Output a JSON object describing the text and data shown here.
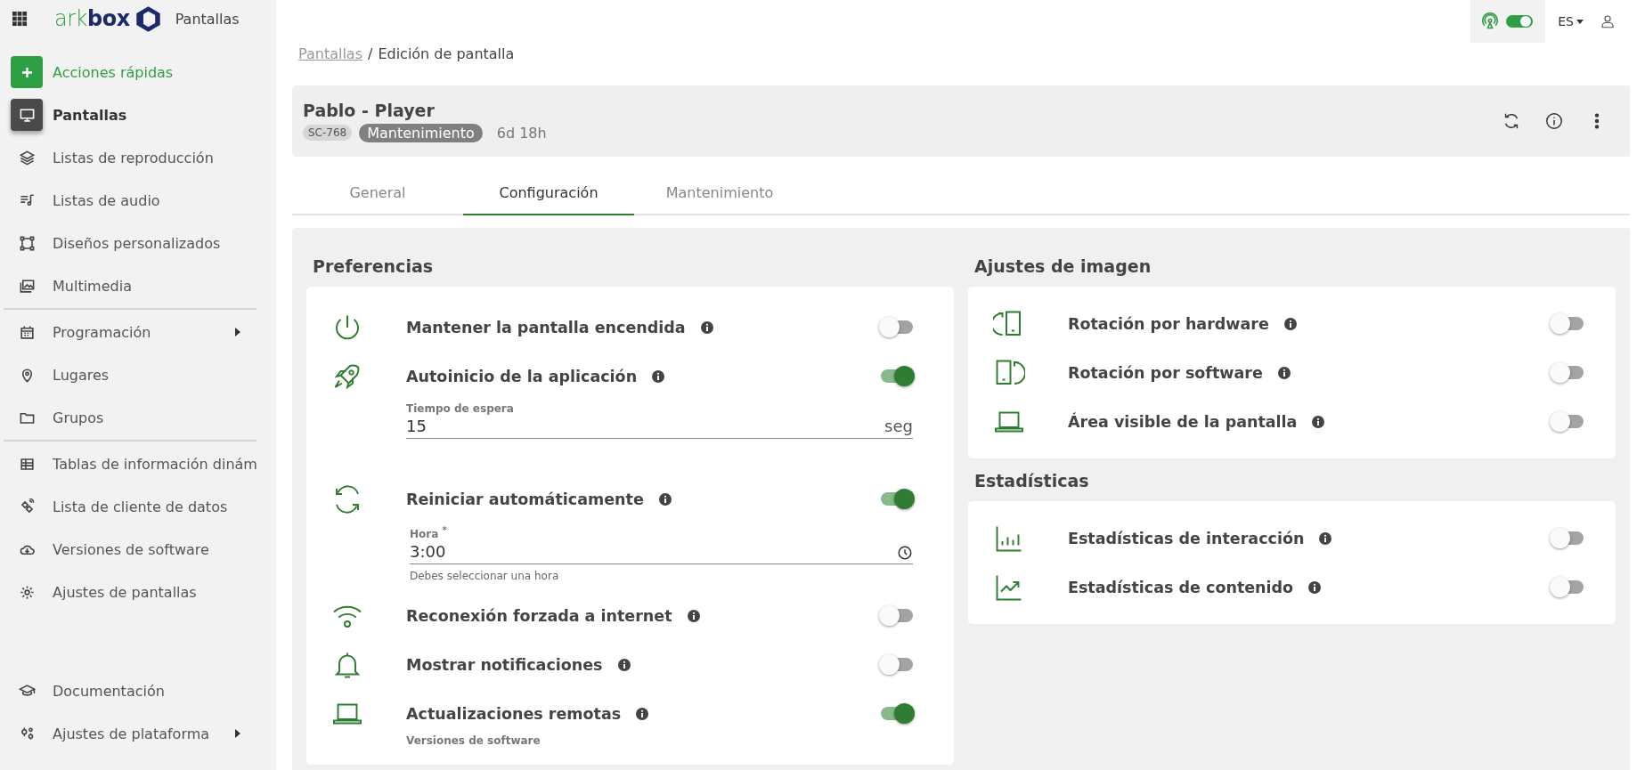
{
  "topbar": {
    "status_toggle": {
      "on": true
    },
    "language": "ES"
  },
  "sidebar": {
    "logo_light": "ark",
    "logo_bold": "box",
    "app_name": "Pantallas",
    "items": [
      {
        "label": "Acciones rápidas",
        "kind": "action",
        "selected": false
      },
      {
        "label": "Pantallas",
        "kind": "nav",
        "selected": true
      },
      {
        "label": "Listas de reproducción",
        "kind": "nav",
        "selected": false
      },
      {
        "label": "Listas de audio",
        "kind": "nav",
        "selected": false
      },
      {
        "label": "Diseños personalizados",
        "kind": "nav",
        "selected": false
      },
      {
        "label": "Multimedia",
        "kind": "nav",
        "selected": false
      },
      {
        "label": "Programación",
        "kind": "nav",
        "selected": false,
        "submenu": true,
        "divider_before": true
      },
      {
        "label": "Lugares",
        "kind": "nav",
        "selected": false
      },
      {
        "label": "Grupos",
        "kind": "nav",
        "selected": false
      },
      {
        "label": "Tablas de información dinám",
        "kind": "nav",
        "selected": false,
        "divider_before": true
      },
      {
        "label": "Lista de cliente de datos",
        "kind": "nav",
        "selected": false
      },
      {
        "label": "Versiones de software",
        "kind": "nav",
        "selected": false
      },
      {
        "label": "Ajustes de pantallas",
        "kind": "nav",
        "selected": false
      }
    ],
    "footer_items": [
      {
        "label": "Documentación",
        "selected": false
      },
      {
        "label": "Ajustes de plataforma",
        "selected": false,
        "submenu": true
      }
    ]
  },
  "breadcrumb": {
    "separator": "/",
    "items": [
      {
        "label": "Pantallas",
        "link": true
      },
      {
        "label": "Edición de pantalla",
        "link": false
      }
    ]
  },
  "header": {
    "title": "Pablo - Player",
    "code": "SC-768",
    "status": "Mantenimiento",
    "uptime": "6d 18h"
  },
  "tabs": [
    {
      "label": "General",
      "selected": false
    },
    {
      "label": "Configuración",
      "selected": true
    },
    {
      "label": "Mantenimiento",
      "selected": false
    }
  ],
  "preferences": {
    "title": "Preferencias",
    "settings": [
      {
        "label": "Mantener la pantalla encendida",
        "on": false
      },
      {
        "label": "Autoinicio de la aplicación",
        "on": true,
        "field": {
          "kind": "number",
          "label": "Tiempo de espera",
          "value": "15",
          "suffix": "seg"
        }
      },
      {
        "label": "Reiniciar automáticamente",
        "on": true,
        "field": {
          "kind": "time",
          "label": "Hora $^{*}$",
          "value": "3:00",
          "hint": "Debes seleccionar una hora"
        }
      },
      {
        "label": "Reconexión forzada a internet",
        "on": false
      },
      {
        "label": "Mostrar notificaciones",
        "on": false
      },
      {
        "label": "Actualizaciones remotas",
        "on": true,
        "field": {
          "kind": "select",
          "label": "Versiones de software"
        }
      }
    ]
  },
  "image_settings": {
    "title": "Ajustes de imagen",
    "settings": [
      {
        "label": "Rotación por hardware",
        "on": false
      },
      {
        "label": "Rotación por software",
        "on": false
      },
      {
        "label": "Área visible de la pantalla",
        "on": false
      }
    ]
  },
  "statistics": {
    "title": "Estadísticas",
    "settings": [
      {
        "label": "Estadísticas de interacción",
        "on": false
      },
      {
        "label": "Estadísticas de contenido",
        "on": false
      }
    ]
  }
}
